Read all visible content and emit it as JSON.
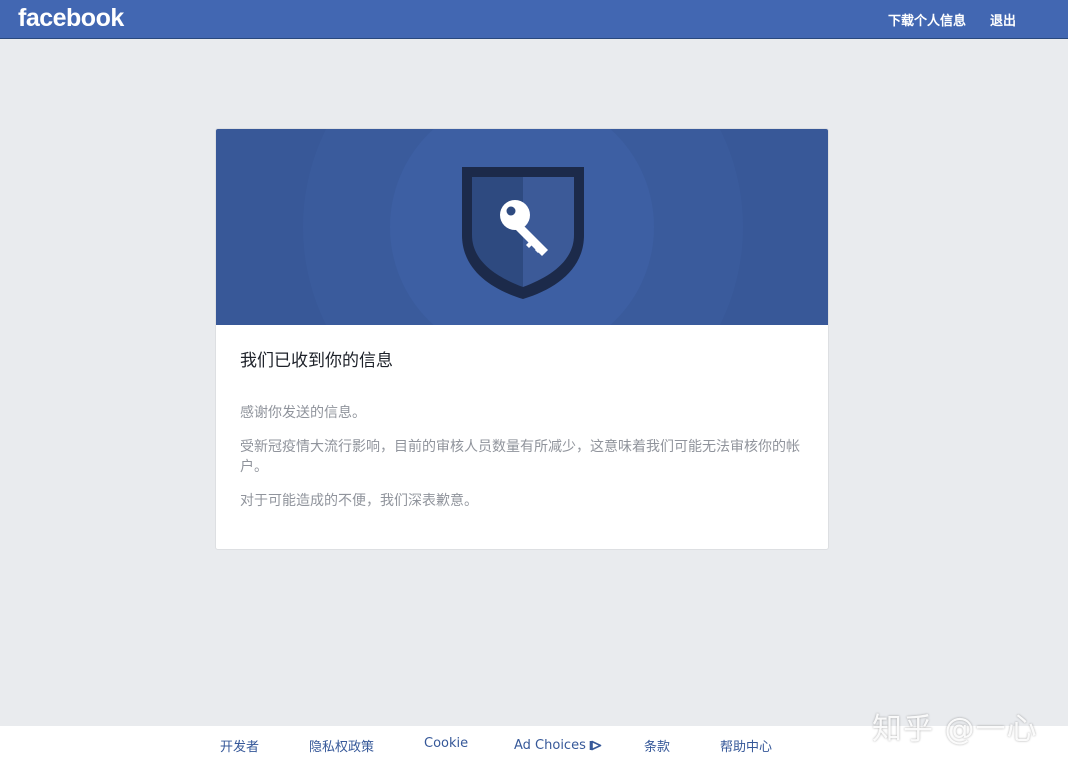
{
  "header": {
    "logo": "facebook",
    "nav": {
      "download_info": "下载个人信息",
      "logout": "退出"
    }
  },
  "card": {
    "title": "我们已收到你的信息",
    "paragraphs": [
      "感谢你发送的信息。",
      "受新冠疫情大流行影响，目前的审核人员数量有所减少，这意味着我们可能无法审核你的帐户。",
      "对于可能造成的不便，我们深表歉意。"
    ]
  },
  "footer": {
    "links": [
      "开发者",
      "隐私权政策",
      "Cookie",
      "Ad Choices",
      "条款",
      "帮助中心"
    ]
  },
  "watermark": "知乎 @一心",
  "colors": {
    "brand_blue": "#4267b2",
    "hero_blue": "#385898",
    "page_bg": "#e9ebee",
    "link_blue": "#365899"
  },
  "icons": {
    "hero": "shield-key-icon",
    "ad_choices": "ad-choices-icon"
  }
}
